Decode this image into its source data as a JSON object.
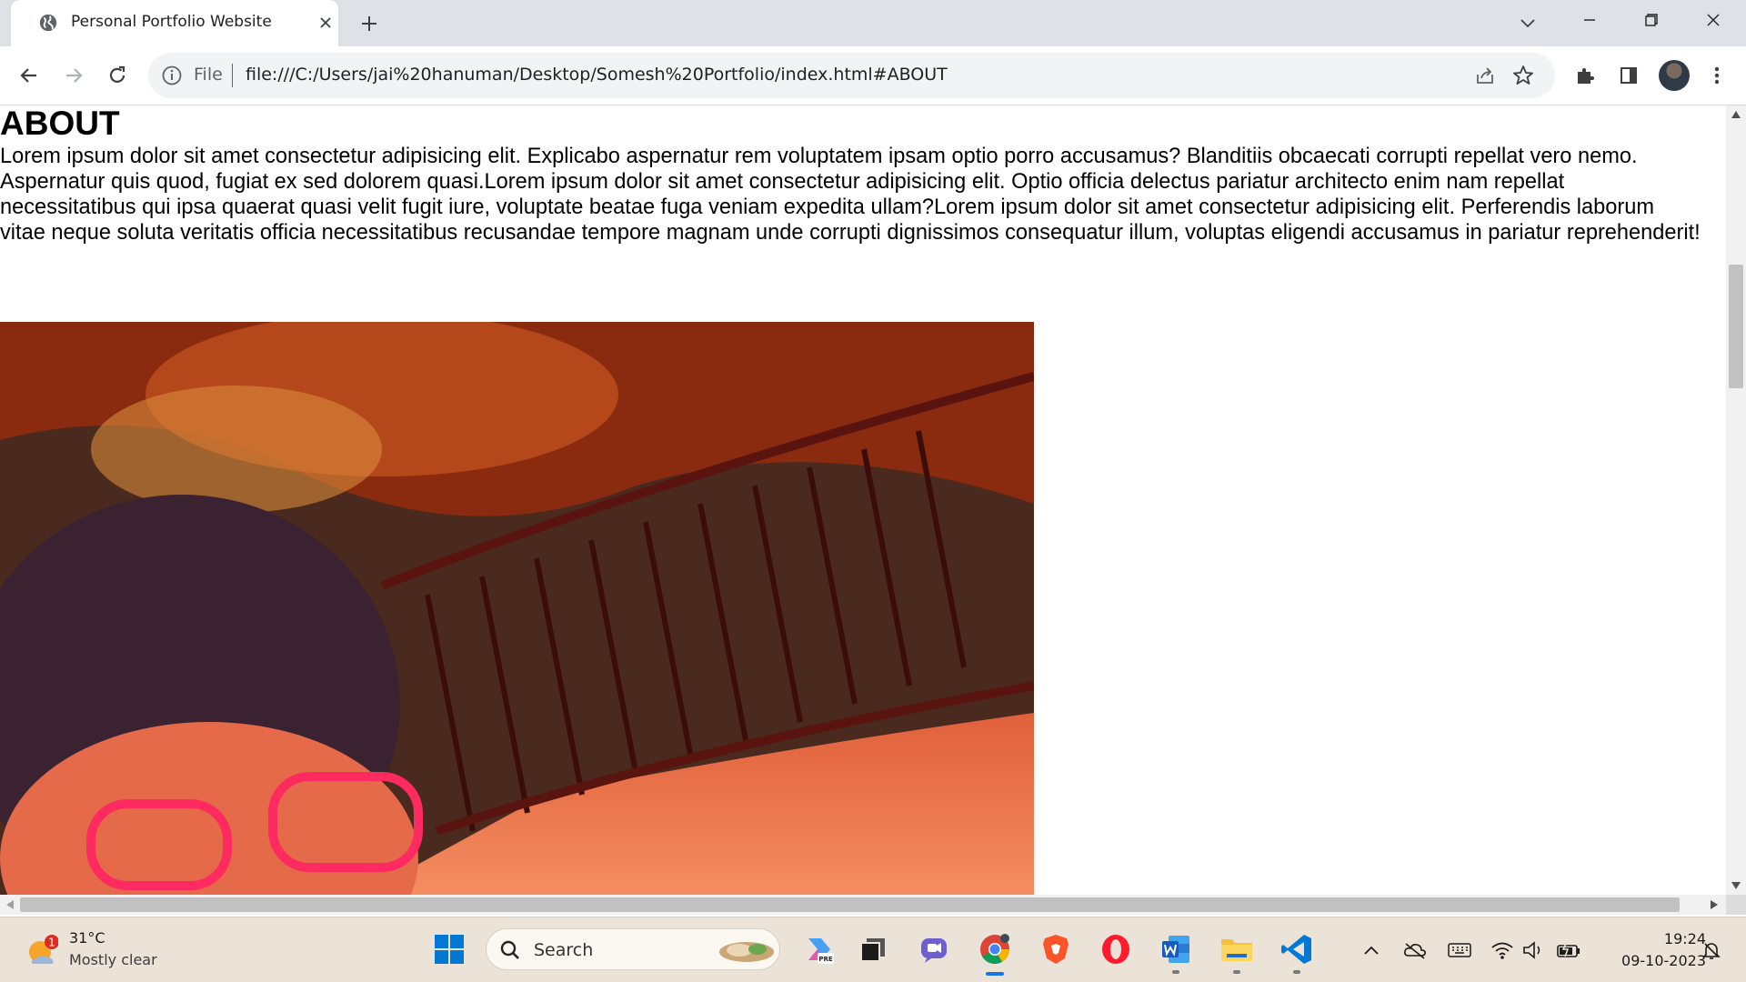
{
  "browser": {
    "tab_title": "Personal Portfolio Website",
    "omnibox": {
      "scheme_label": "File",
      "url": "file:///C:/Users/jai%20hanuman/Desktop/Somesh%20Portfolio/index.html#ABOUT"
    }
  },
  "page": {
    "heading": "ABOUT",
    "paragraph": "Lorem ipsum dolor sit amet consectetur adipisicing elit. Explicabo aspernatur rem voluptatem ipsam optio porro accusamus? Blanditiis obcaecati corrupti repellat vero nemo. Aspernatur quis quod, fugiat ex sed dolorem quasi.Lorem ipsum dolor sit amet consectetur adipisicing elit. Optio officia delectus pariatur architecto enim nam repellat necessitatibus qui ipsa quaerat quasi velit fugit iure, voluptate beatae fuga veniam expedita ullam?Lorem ipsum dolor sit amet consectetur adipisicing elit. Perferendis laborum vitae neque soluta veritatis officia necessitatibus recusandae tempore magnam unde corrupti dignissimos consequatur illum, voluptas eligendi accusamus in pariatur reprehenderit!"
  },
  "taskbar": {
    "weather": {
      "temperature": "31°C",
      "condition": "Mostly clear",
      "badge_count": "1"
    },
    "search_label": "Search",
    "clock": {
      "time": "19:24",
      "date": "09-10-2023"
    }
  },
  "colors": {
    "tabstrip": "#dee1e6",
    "taskbar": "#ece3d8",
    "windows_blue": "#0078d4",
    "chrome_active_indicator": "#1a73e8"
  }
}
